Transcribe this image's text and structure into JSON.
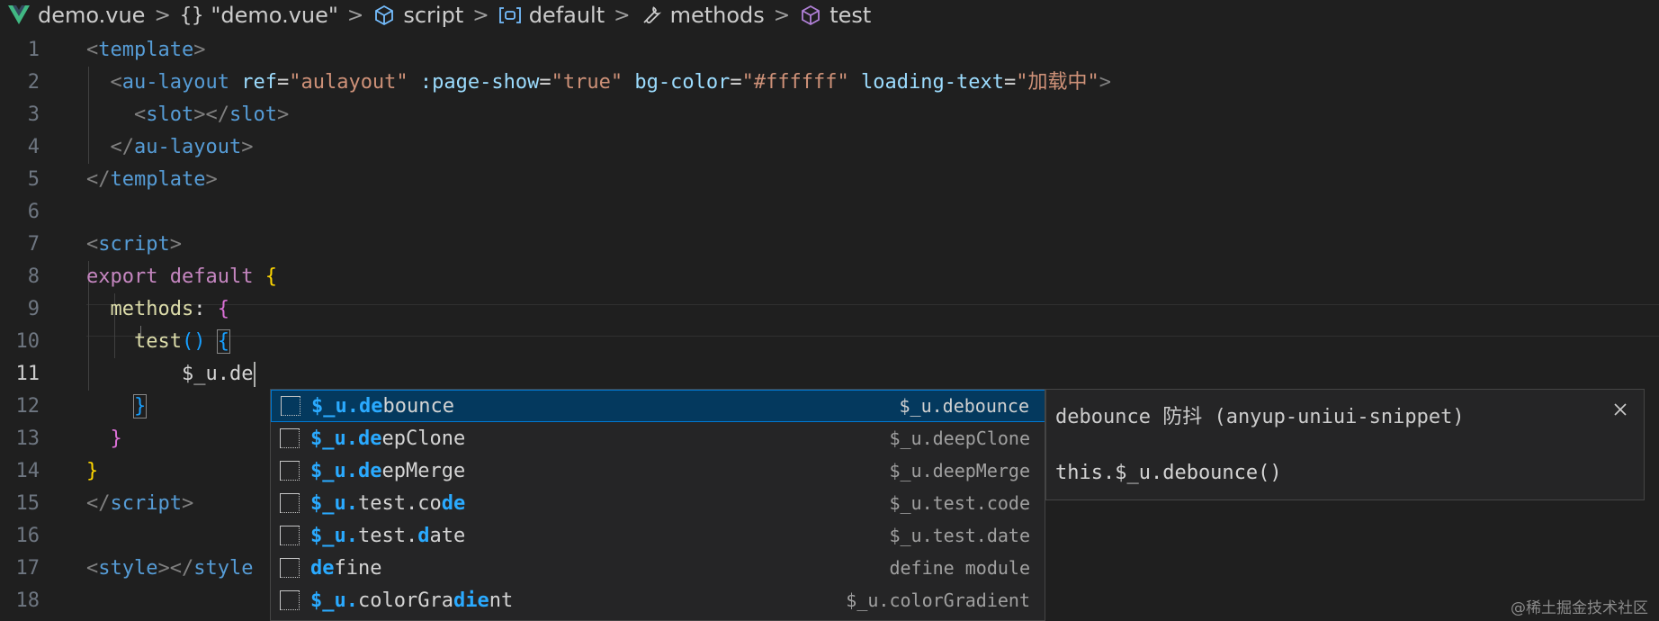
{
  "breadcrumb": {
    "file": "demo.vue",
    "json_node": "\"demo.vue\"",
    "json_braces": "{}",
    "script": "script",
    "default": "default",
    "methods": "methods",
    "test": "test"
  },
  "editor": {
    "line_numbers": [
      "1",
      "2",
      "3",
      "4",
      "5",
      "6",
      "7",
      "8",
      "9",
      "10",
      "11",
      "12",
      "13",
      "14",
      "15",
      "16",
      "17",
      "18"
    ],
    "active_line": "11",
    "code": {
      "l1_open": "<",
      "l1_tag": "template",
      "l1_close": ">",
      "l2_open": "<",
      "l2_tag": "au-layout",
      "l2_attr1": "ref",
      "l2_eq1": "=",
      "l2_val1": "\"aulayout\"",
      "l2_attr2": ":page-show",
      "l2_eq2": "=",
      "l2_val2": "\"true\"",
      "l2_attr3": "bg-color",
      "l2_eq3": "=",
      "l2_val3": "\"#ffffff\"",
      "l2_attr4": "loading-text",
      "l2_eq4": "=",
      "l2_val4": "\"加载中\"",
      "l2_close": ">",
      "l3_open": "<",
      "l3_tag": "slot",
      "l3_mid": "></",
      "l3_tag2": "slot",
      "l3_close": ">",
      "l4_open": "</",
      "l4_tag": "au-layout",
      "l4_close": ">",
      "l5_open": "</",
      "l5_tag": "template",
      "l5_close": ">",
      "l7_open": "<",
      "l7_tag": "script",
      "l7_close": ">",
      "l8_kw1": "export",
      "l8_kw2": "default",
      "l8_brace": "{",
      "l9_key": "methods",
      "l9_colon": ":",
      "l9_brace": "{",
      "l10_fn": "test",
      "l10_paren": "()",
      "l10_brace": "{",
      "l11_text": "$_u.de",
      "l12_brace": "}",
      "l13_brace": "}",
      "l14_brace": "}",
      "l15_open": "</",
      "l15_tag": "script",
      "l15_close": ">",
      "l17_open": "<",
      "l17_tag": "style",
      "l17_mid": "></",
      "l17_tag2": "style"
    }
  },
  "suggest": {
    "items": [
      {
        "pre": "",
        "hl1": "$_u.de",
        "mid": "bounce",
        "hl2": "",
        "post": "",
        "detail": "$_u.debounce"
      },
      {
        "pre": "",
        "hl1": "$_u.de",
        "mid": "epClone",
        "hl2": "",
        "post": "",
        "detail": "$_u.deepClone"
      },
      {
        "pre": "",
        "hl1": "$_u.de",
        "mid": "epMerge",
        "hl2": "",
        "post": "",
        "detail": "$_u.deepMerge"
      },
      {
        "pre": "",
        "hl1": "$_u.",
        "mid": "test.co",
        "hl2": "de",
        "post": "",
        "detail": "$_u.test.code"
      },
      {
        "pre": "",
        "hl1": "$_u.",
        "mid": "test.",
        "hl2": "d",
        "post": "ate",
        "detail": "$_u.test.date"
      },
      {
        "pre": "",
        "hl1": "de",
        "mid": "fine",
        "hl2": "",
        "post": "",
        "detail": "define module"
      },
      {
        "pre": "",
        "hl1": "$_u.",
        "mid": "colorGra",
        "hl2": "die",
        "post": "nt",
        "detail": "$_u.colorGradient"
      }
    ]
  },
  "details": {
    "title": "debounce 防抖 (anyup-uniui-snippet)",
    "code": "this.$_u.debounce()"
  },
  "watermark": "@稀土掘金技术社区",
  "colors": {
    "background": "#1f1f1f",
    "tag": "#569cd6",
    "attribute": "#9cdcfe",
    "string": "#ce9178",
    "keyword": "#c586c0",
    "function": "#dcdcaa",
    "match_highlight": "#2aaaff",
    "selection": "#04395e"
  }
}
